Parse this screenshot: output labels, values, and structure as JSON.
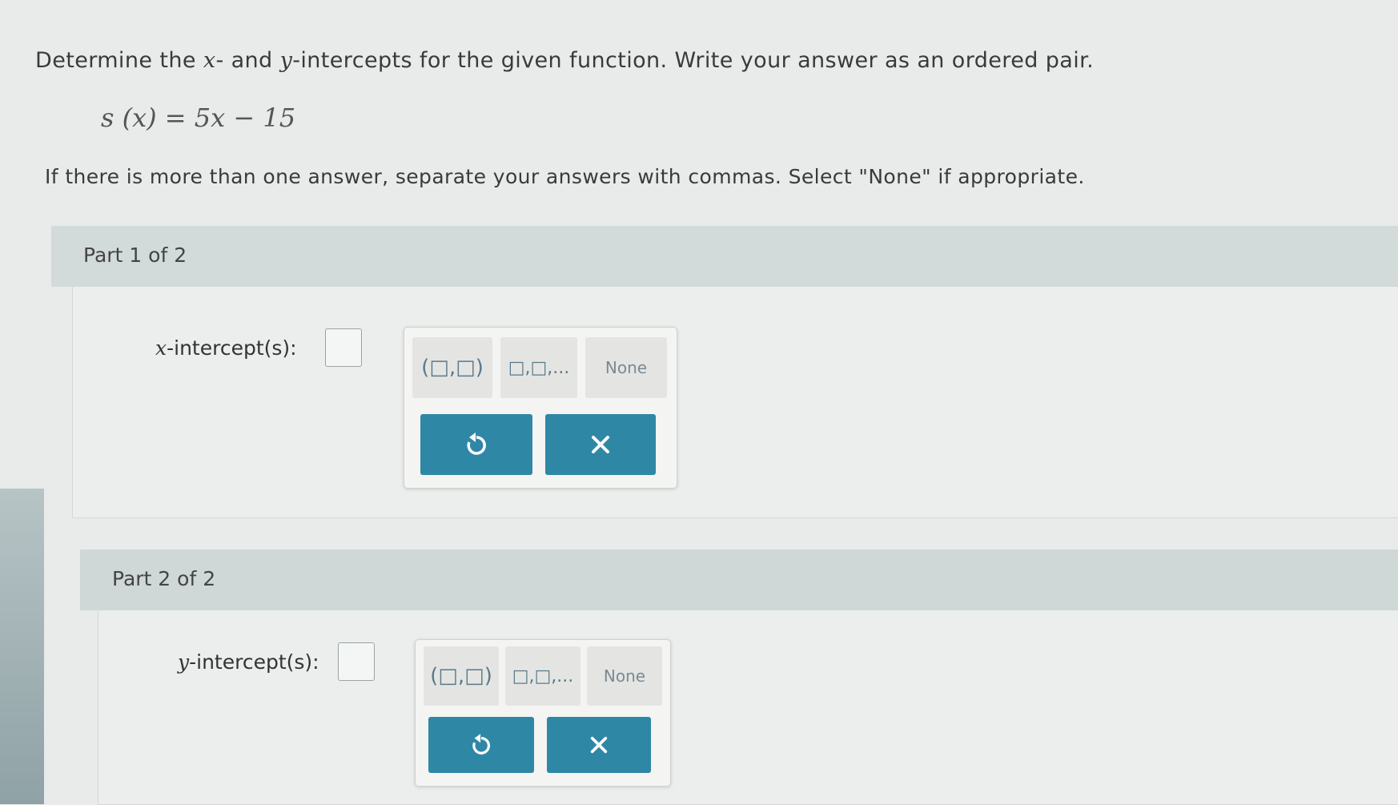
{
  "question": {
    "prompt_1": "Determine the ",
    "var_x": "x",
    "prompt_2": "- and ",
    "var_y": "y",
    "prompt_3": "-intercepts for the given function. Write your answer as an ordered pair.",
    "equation": "s (x) = 5x − 15",
    "instruction": "If there is more than one answer, separate your answers with commas. Select \"None\" if appropriate."
  },
  "parts": [
    {
      "header": "Part 1 of 2",
      "field_var": "x",
      "field_label": "-intercept(s):",
      "answer_value": "",
      "keypad": {
        "ordered_pair_key": "(□,□)",
        "list_key": "□,□,...",
        "none_key": "None",
        "undo_icon": "undo-icon",
        "clear_icon": "close-icon"
      }
    },
    {
      "header": "Part 2 of 2",
      "field_var": "y",
      "field_label": "-intercept(s):",
      "answer_value": "",
      "keypad": {
        "ordered_pair_key": "(□,□)",
        "list_key": "□,□,...",
        "none_key": "None",
        "undo_icon": "undo-icon",
        "clear_icon": "close-icon"
      }
    }
  ],
  "colors": {
    "action_button": "#2f87a6",
    "part_header": "#d3dbda",
    "background": "#e9ebea"
  }
}
